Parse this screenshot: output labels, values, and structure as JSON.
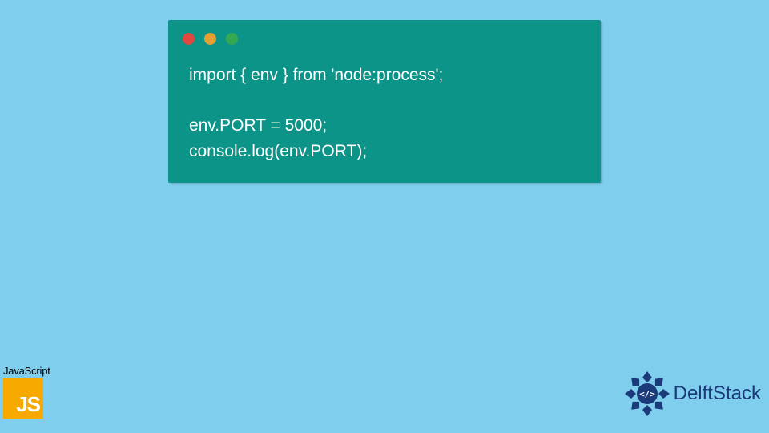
{
  "code": {
    "line1": "import { env } from 'node:process';",
    "line2": "env.PORT = 5000;",
    "line3": "console.log(env.PORT);"
  },
  "traffic_lights": {
    "red": "close",
    "yellow": "minimize",
    "green": "maximize"
  },
  "badges": {
    "js_label": "JavaScript",
    "js_logo_text": "JS",
    "delft_text": "DelftStack"
  },
  "colors": {
    "page_bg": "#80ceee",
    "code_bg": "#0d9488",
    "code_text": "#ffffff",
    "js_bg": "#f7a900",
    "delft_blue": "#1b3a7a"
  }
}
